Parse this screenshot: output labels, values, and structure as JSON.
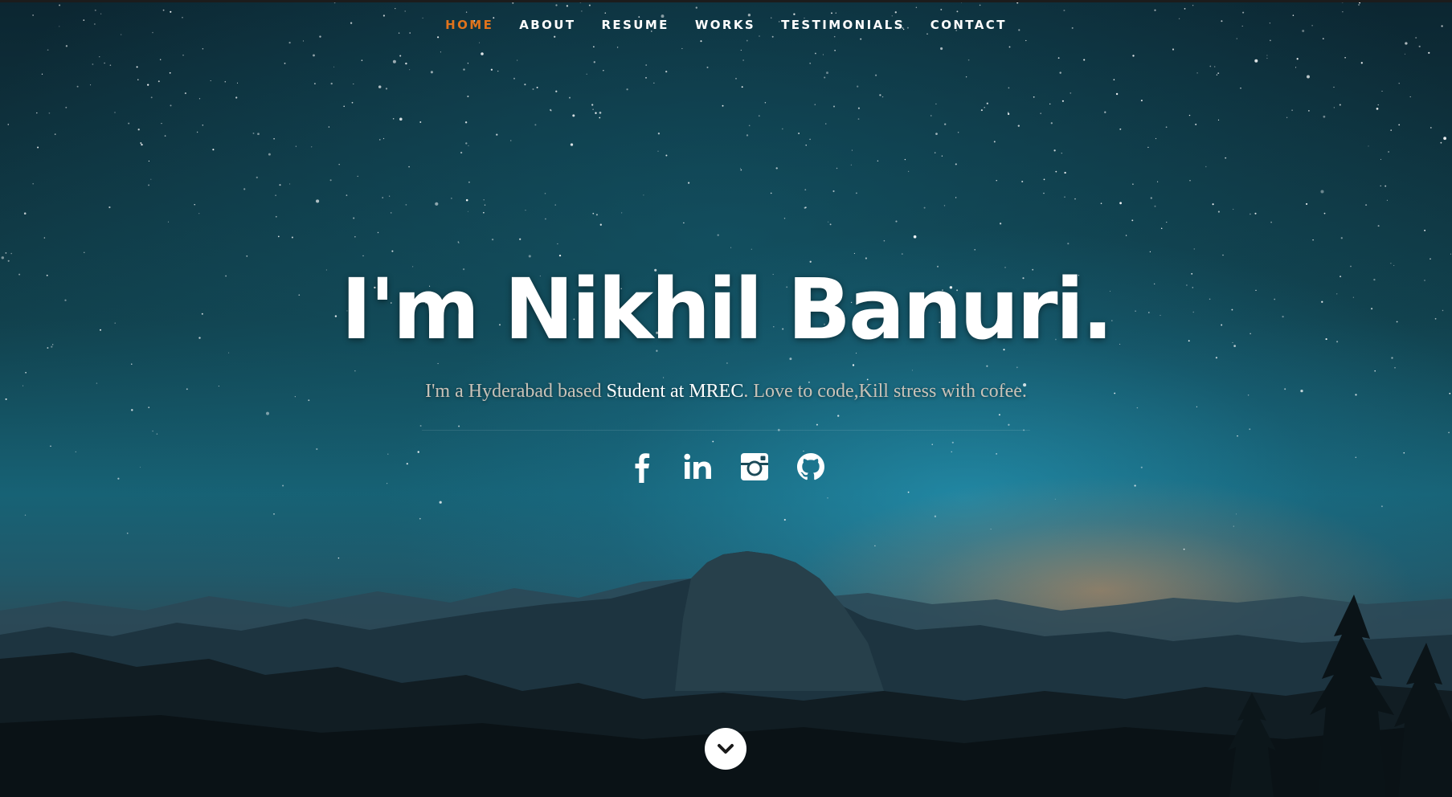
{
  "nav": {
    "items": [
      {
        "label": "HOME",
        "active": true
      },
      {
        "label": "ABOUT",
        "active": false
      },
      {
        "label": "RESUME",
        "active": false
      },
      {
        "label": "WORKS",
        "active": false
      },
      {
        "label": "TESTIMONIALS",
        "active": false
      },
      {
        "label": "CONTACT",
        "active": false
      }
    ],
    "active_color": "#e0731c"
  },
  "hero": {
    "headline": "I'm Nikhil Banuri.",
    "tagline_pre": "I'm a Hyderabad based ",
    "tagline_highlight": "Student at MREC",
    "tagline_post": ". Love to code,Kill stress with cofee."
  },
  "social": {
    "icons": [
      "facebook-icon",
      "linkedin-icon",
      "instagram-icon",
      "github-icon"
    ]
  },
  "scroll": {
    "icon": "chevron-down-icon"
  }
}
